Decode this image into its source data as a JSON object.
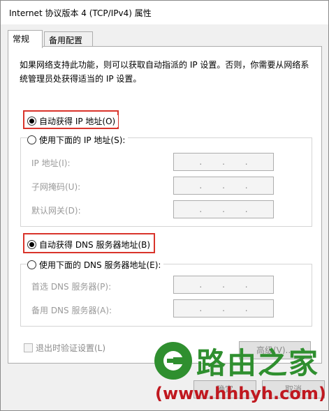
{
  "window": {
    "title": "Internet 协议版本 4 (TCP/IPv4) 属性"
  },
  "tabs": [
    {
      "label": "常规",
      "active": true
    },
    {
      "label": "备用配置",
      "active": false
    }
  ],
  "description": "如果网络支持此功能，则可以获取自动指派的 IP 设置。否则，你需要从网络系统管理员处获得适当的 IP 设置。",
  "ip_section": {
    "auto_radio": {
      "label": "自动获得 IP 地址(O)",
      "checked": true
    },
    "manual_radio": {
      "label": "使用下面的 IP 地址(S):",
      "checked": false
    },
    "fields": [
      {
        "label": "IP 地址(I):",
        "dots": [
          ".",
          ".",
          "."
        ]
      },
      {
        "label": "子网掩码(U):",
        "dots": [
          ".",
          ".",
          "."
        ]
      },
      {
        "label": "默认网关(D):",
        "dots": [
          ".",
          ".",
          "."
        ]
      }
    ]
  },
  "dns_section": {
    "auto_radio": {
      "label": "自动获得 DNS 服务器地址(B)",
      "checked": true
    },
    "manual_radio": {
      "label": "使用下面的 DNS 服务器地址(E):",
      "checked": false
    },
    "fields": [
      {
        "label": "首选 DNS 服务器(P):",
        "dots": [
          ".",
          ".",
          "."
        ]
      },
      {
        "label": "备用 DNS 服务器(A):",
        "dots": [
          ".",
          ".",
          "."
        ]
      }
    ]
  },
  "validate_checkbox": {
    "label": "退出时验证设置(L)",
    "checked": false
  },
  "buttons": {
    "advanced": "高级(V)...",
    "ok": "确定",
    "cancel": "取消"
  },
  "watermark": {
    "brand": "路由之家",
    "url": "(www.hhhyh.com)"
  },
  "colors": {
    "highlight": "#d9342b",
    "watermark_green": "#2f8f2f",
    "watermark_red": "#c0181f"
  }
}
